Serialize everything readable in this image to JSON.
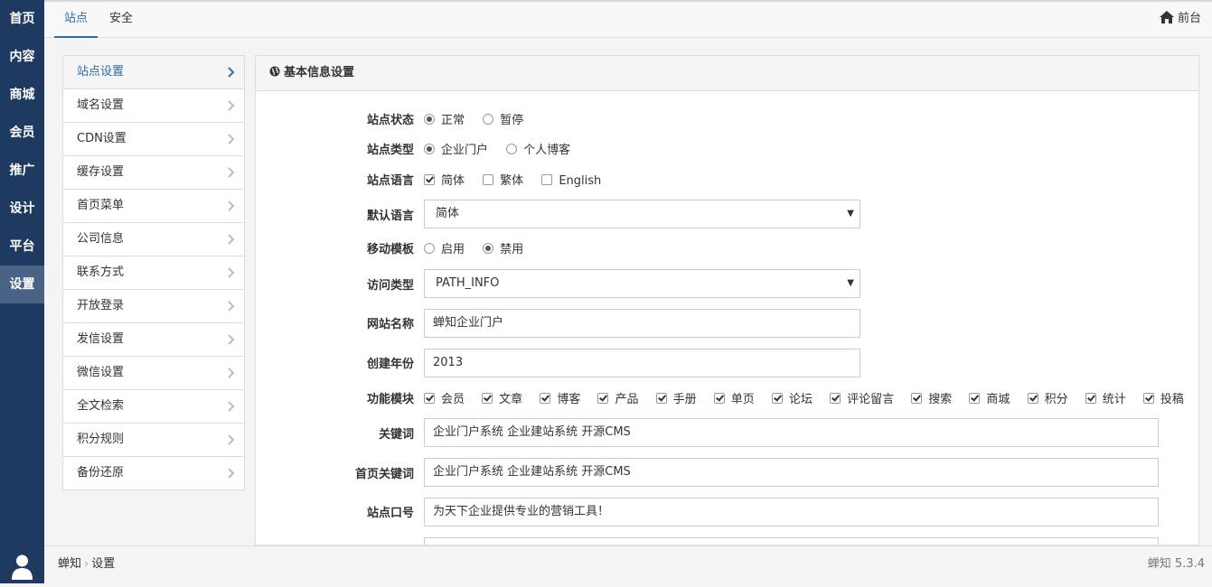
{
  "leftnav": {
    "items": [
      {
        "label": "首页"
      },
      {
        "label": "内容"
      },
      {
        "label": "商城"
      },
      {
        "label": "会员"
      },
      {
        "label": "推广"
      },
      {
        "label": "设计"
      },
      {
        "label": "平台"
      },
      {
        "label": "设置"
      }
    ],
    "active": 7
  },
  "topbar": {
    "tabs": [
      {
        "label": "站点"
      },
      {
        "label": "安全"
      }
    ],
    "front_label": "前台"
  },
  "sidemenu": {
    "items": [
      {
        "label": "站点设置"
      },
      {
        "label": "域名设置"
      },
      {
        "label": "CDN设置"
      },
      {
        "label": "缓存设置"
      },
      {
        "label": "首页菜单"
      },
      {
        "label": "公司信息"
      },
      {
        "label": "联系方式"
      },
      {
        "label": "开放登录"
      },
      {
        "label": "发信设置"
      },
      {
        "label": "微信设置"
      },
      {
        "label": "全文检索"
      },
      {
        "label": "积分规则"
      },
      {
        "label": "备份还原"
      }
    ]
  },
  "panel": {
    "title": "基本信息设置"
  },
  "form": {
    "site_status": {
      "label": "站点状态",
      "options": [
        {
          "label": "正常",
          "checked": true
        },
        {
          "label": "暂停",
          "checked": false
        }
      ]
    },
    "site_type": {
      "label": "站点类型",
      "options": [
        {
          "label": "企业门户",
          "checked": true
        },
        {
          "label": "个人博客",
          "checked": false
        }
      ]
    },
    "site_lang": {
      "label": "站点语言",
      "options": [
        {
          "label": "简体",
          "checked": true
        },
        {
          "label": "繁体",
          "checked": false
        },
        {
          "label": "English",
          "checked": false
        }
      ]
    },
    "default_lang": {
      "label": "默认语言",
      "value": "简体"
    },
    "mobile_tpl": {
      "label": "移动模板",
      "options": [
        {
          "label": "启用",
          "checked": false
        },
        {
          "label": "禁用",
          "checked": true
        }
      ]
    },
    "access_type": {
      "label": "访问类型",
      "value": "PATH_INFO"
    },
    "site_name": {
      "label": "网站名称",
      "value": "蝉知企业门户"
    },
    "year": {
      "label": "创建年份",
      "value": "2013"
    },
    "modules": {
      "label": "功能模块",
      "options": [
        {
          "label": "会员"
        },
        {
          "label": "文章"
        },
        {
          "label": "博客"
        },
        {
          "label": "产品"
        },
        {
          "label": "手册"
        },
        {
          "label": "单页"
        },
        {
          "label": "论坛"
        },
        {
          "label": "评论留言"
        },
        {
          "label": "搜索"
        },
        {
          "label": "商城"
        },
        {
          "label": "积分"
        },
        {
          "label": "统计"
        },
        {
          "label": "投稿"
        }
      ]
    },
    "keywords": {
      "label": "关键词",
      "value": "企业门户系统 企业建站系统 开源CMS"
    },
    "index_keywords": {
      "label": "首页关键词",
      "value": "企业门户系统 企业建站系统 开源CMS"
    },
    "slogan": {
      "label": "站点口号",
      "value": "为天下企业提供专业的营销工具！"
    }
  },
  "footer": {
    "crumb": [
      "蝉知",
      "设置"
    ],
    "version": "蝉知 5.3.4"
  }
}
